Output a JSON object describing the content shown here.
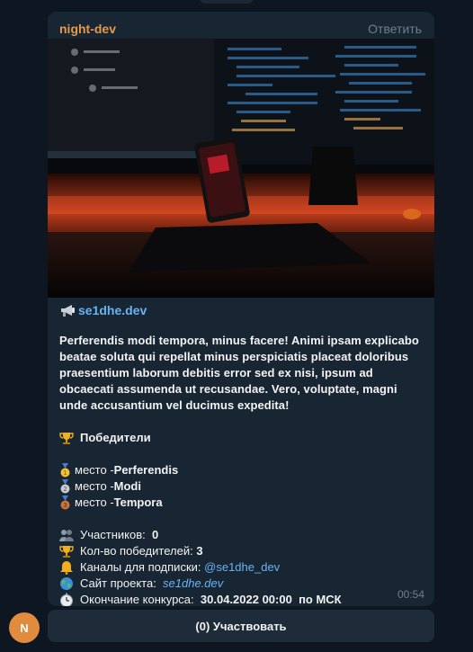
{
  "message": {
    "author": "night-dev",
    "reply_label": "Ответить",
    "link_text": "se1dhe.dev",
    "description": "Perferendis modi tempora, minus facere! Animi ipsam explicabo beatae soluta qui repellat minus perspiciatis placeat doloribus praesentium laborum debitis error sed ex nisi, ipsum ad obcaecati assumenda ut recusandae. Vero, voluptate, magni unde accusantium vel ducimus expedita!",
    "winners_title": "Победители",
    "winners": [
      {
        "prefix": "место -",
        "name": "Perferendis",
        "medal": "gold"
      },
      {
        "prefix": "место - ",
        "name": "Modi",
        "medal": "silver"
      },
      {
        "prefix": "место - ",
        "name": "Tempora",
        "medal": "bronze"
      }
    ],
    "participants_label": "Участников:",
    "participants_value": "0",
    "winners_count_label": "Кол-во победителей:",
    "winners_count_value": "3",
    "channels_label": "Каналы для подписки:",
    "channels_value": "@se1dhe_dev",
    "site_label": "Сайт проекта:",
    "site_value": "se1dhe.dev",
    "end_label": "Окончание конкурса:",
    "end_value": "30.04.2022 00:00",
    "end_suffix": "по МСК",
    "time": "00:54"
  },
  "avatar_letter": "N",
  "participate_button": "(0) Участвовать",
  "icons": {
    "megaphone": "megaphone-icon",
    "trophy": "trophy-icon",
    "participants": "people-icon",
    "bell": "bell-icon",
    "globe": "globe-icon",
    "timer": "stopwatch-icon"
  },
  "colors": {
    "background": "#0e1621",
    "bubble": "#182533",
    "author": "#e39a4a",
    "link": "#6ab3f3",
    "avatar": "#e08b3e"
  }
}
